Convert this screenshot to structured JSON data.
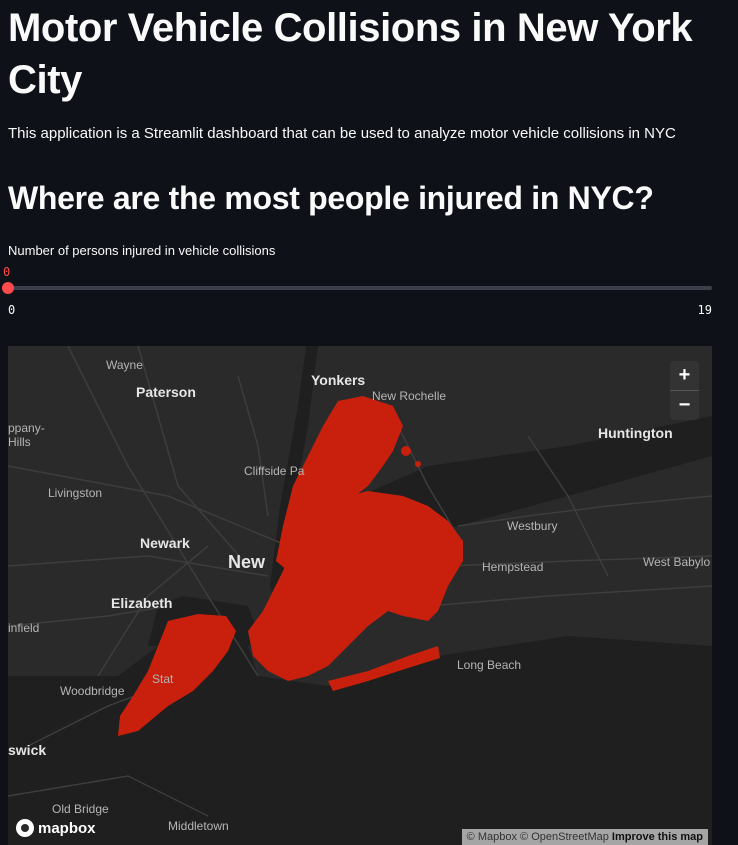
{
  "title": "Motor Vehicle Collisions in New York City",
  "intro": "This application is a Streamlit dashboard that can be used to analyze motor vehicle collisions in NYC",
  "subheader": "Where are the most people injured in NYC?",
  "slider": {
    "label": "Number of persons injured in vehicle collisions",
    "value": "0",
    "min": "0",
    "max": "19",
    "accent": "#ff4b4b"
  },
  "map": {
    "places": {
      "wayne": "Wayne",
      "paterson": "Paterson",
      "yonkers": "Yonkers",
      "new_rochelle": "New Rochelle",
      "huntington": "Huntington",
      "hills": "ppany-\nHills",
      "cliffside": "Cliffside Pa",
      "livingston": "Livingston",
      "westbury": "Westbury",
      "newark": "Newark",
      "new_york": "New",
      "hempstead": "Hempstead",
      "west_babylon": "West Babylo",
      "elizabeth": "Elizabeth",
      "plainfield": "infield",
      "long_beach": "Long Beach",
      "staten": "Stat",
      "woodbridge": "Woodbridge",
      "brunswick": "swick",
      "old_bridge": "Old Bridge",
      "middletown": "Middletown"
    },
    "zoom_in": "+",
    "zoom_out": "−",
    "logo": "mapbox",
    "attribution": {
      "mapbox": "© Mapbox",
      "osm": "© OpenStreetMap",
      "improve": "Improve this map"
    },
    "point_color": "#c8200c"
  }
}
